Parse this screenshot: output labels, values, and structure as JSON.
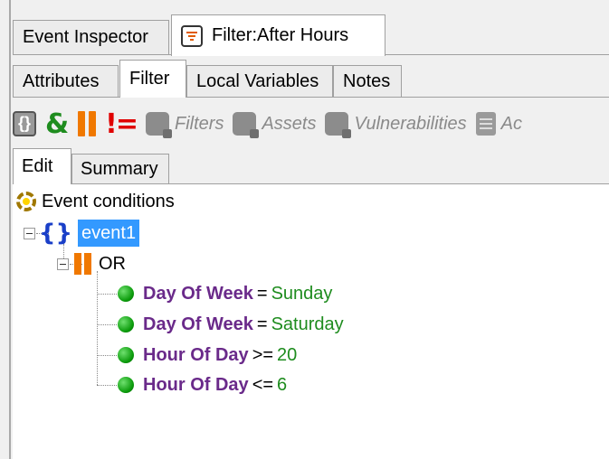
{
  "tabs_top": [
    {
      "label": "Event Inspector",
      "active": false
    },
    {
      "label": "Filter:After Hours",
      "active": true,
      "icon": "filter-icon"
    }
  ],
  "tabs_sub": [
    {
      "label": "Attributes",
      "active": false
    },
    {
      "label": "Filter",
      "active": true
    },
    {
      "label": "Local Variables",
      "active": false
    },
    {
      "label": "Notes",
      "active": false
    }
  ],
  "toolbar": {
    "filters_label": "Filters",
    "assets_label": "Assets",
    "vulnerabilities_label": "Vulnerabilities",
    "truncated_label": "Ac"
  },
  "tabs_edit": [
    {
      "label": "Edit",
      "active": true
    },
    {
      "label": "Summary",
      "active": false
    }
  ],
  "tree": {
    "root_label": "Event conditions",
    "event_label": "event1",
    "or_label": "OR",
    "conditions": [
      {
        "field": "Day Of Week",
        "op": "=",
        "value": "Sunday"
      },
      {
        "field": "Day Of Week",
        "op": "=",
        "value": "Saturday"
      },
      {
        "field": "Hour Of Day",
        "op": ">=",
        "value": "20"
      },
      {
        "field": "Hour Of Day",
        "op": "<=",
        "value": "6"
      }
    ]
  },
  "colors": {
    "selection": "#3399ff",
    "field": "#6a2a8a",
    "value": "#1e8c1e",
    "or_operator": "#f07800",
    "not_operator": "#e00000",
    "and_operator": "#1e8c1e",
    "braces": "#1a3fc8"
  }
}
